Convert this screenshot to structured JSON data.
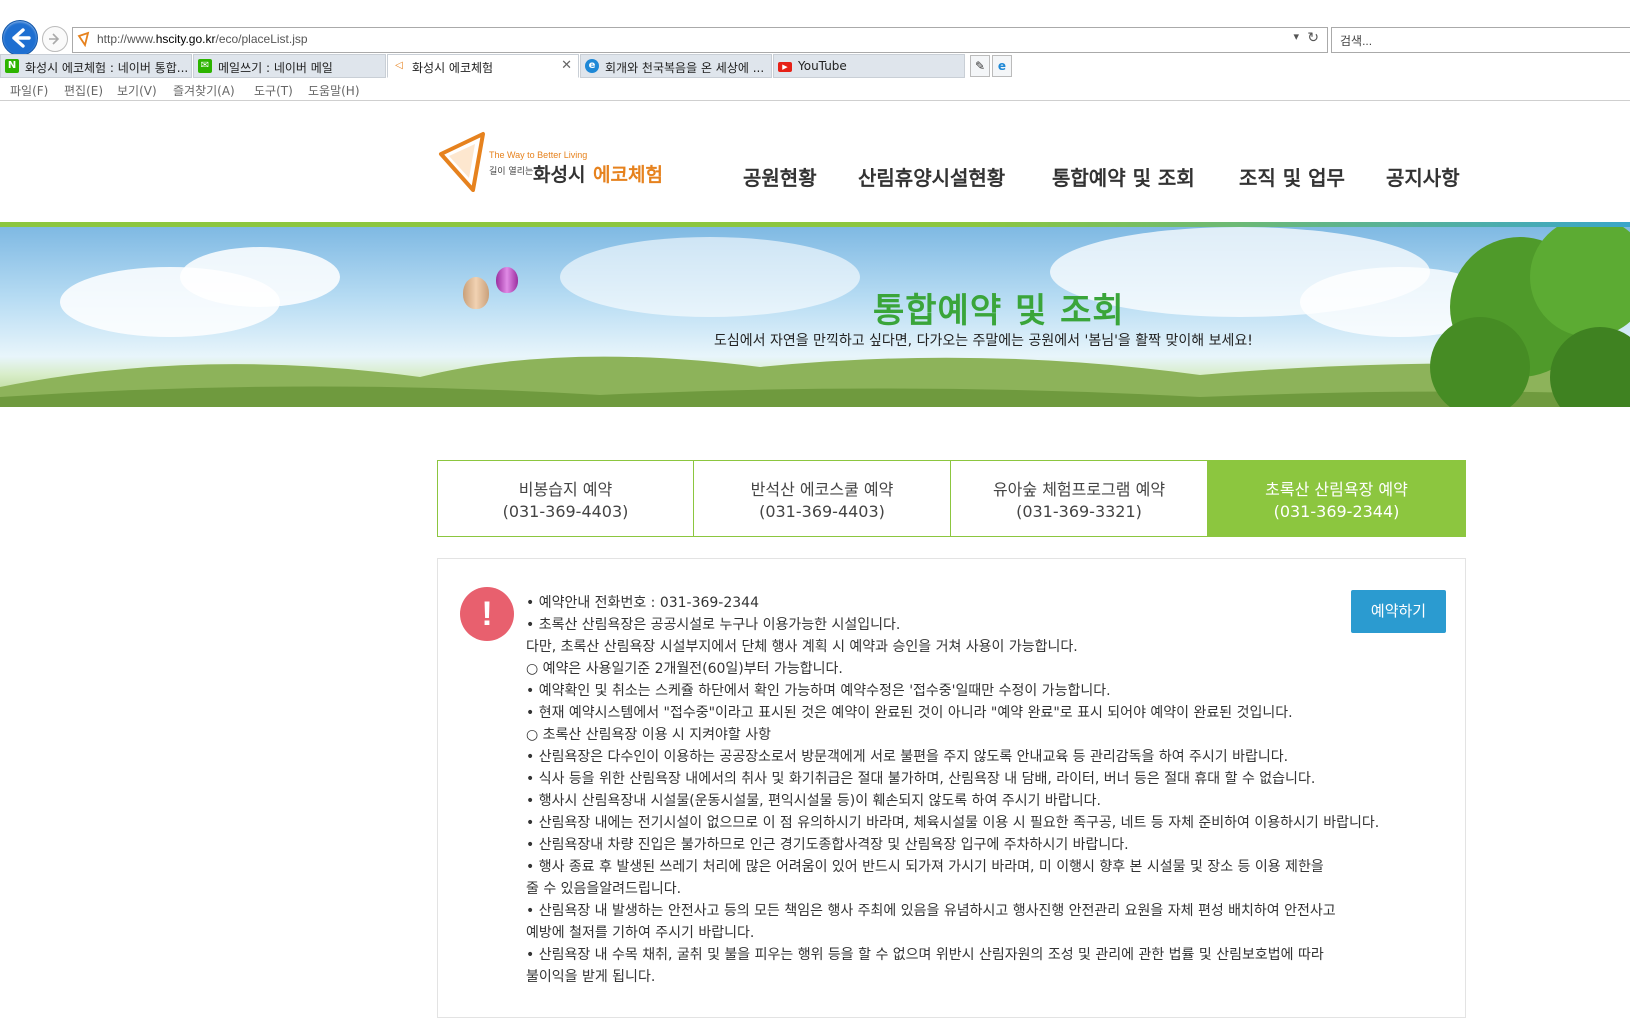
{
  "browser": {
    "url_prefix": "http://www.",
    "url_domain": "hscity.go.kr",
    "url_path": "/eco/placeList.jsp",
    "search_placeholder": "검색...",
    "tabs": [
      {
        "label": "화성시 에코체험 : 네이버 통합...",
        "icon": "naver-icon"
      },
      {
        "label": "메일쓰기 : 네이버 메일",
        "icon": "naver-mail-icon"
      },
      {
        "label": "화성시 에코체험",
        "icon": "hscity-site-icon"
      },
      {
        "label": "회개와 천국복음을 온 세상에 ...",
        "icon": "ie-page-icon"
      },
      {
        "label": "YouTube",
        "icon": "youtube-icon"
      }
    ],
    "menu": [
      "파일(F)",
      "편집(E)",
      "보기(V)",
      "즐겨찾기(A)",
      "도구(T)",
      "도움말(H)"
    ]
  },
  "site": {
    "logo_tagline": "The Way to Better Living",
    "logo_small": "길이 열리는",
    "logo_name_a": "화성시",
    "logo_name_b": "에코체험",
    "nav": [
      "공원현황",
      "산림휴양시설현황",
      "통합예약 및 조회",
      "조직 및 업무",
      "공지사항"
    ]
  },
  "banner": {
    "title": "통합예약 및 조회",
    "subtitle": "도심에서 자연을 만끽하고 싶다면, 다가오는 주말에는 공원에서 '봄님'을 활짝 맞이해 보세요!"
  },
  "reservation_tabs": [
    {
      "name": "비봉습지 예약",
      "phone": "(031-369-4403)",
      "active": false
    },
    {
      "name": "반석산 에코스쿨 예약",
      "phone": "(031-369-4403)",
      "active": false
    },
    {
      "name": "유아숲 체험프로그램 예약",
      "phone": "(031-369-3321)",
      "active": false
    },
    {
      "name": "초록산 산림욕장 예약",
      "phone": "(031-369-2344)",
      "active": true
    }
  ],
  "notice": {
    "reserve_button": "예약하기",
    "lines": [
      "• 예약안내 전화번호 : 031-369-2344",
      "•  초록산 산림욕장은 공공시설로 누구나 이용가능한 시설입니다.",
      "다만, 초록산 산림욕장 시설부지에서 단체 행사 계획 시 예약과 승인을 거쳐 사용이 가능합니다.",
      "○ 예약은 사용일기준 2개월전(60일)부터 가능합니다.",
      "• 예약확인 및 취소는 스케쥴 하단에서 확인 가능하며 예약수정은 '접수중'일때만 수정이 가능합니다.",
      "• 현재 예약시스템에서 \"접수중\"이라고 표시된 것은 예약이 완료된 것이 아니라 \"예약 완료\"로 표시 되어야 예약이 완료된 것입니다.",
      "○ 초록산 산림욕장 이용 시 지켜야할 사항",
      "• 산림욕장은 다수인이 이용하는 공공장소로서 방문객에게 서로 불편을 주지 않도록 안내교육 등 관리감독을 하여 주시기 바랍니다.",
      "• 식사 등을 위한 산림욕장 내에서의 취사 및 화기취급은 절대 불가하며, 산림욕장 내 담배, 라이터, 버너 등은 절대 휴대 할 수 없습니다.",
      "• 행사시 산림욕장내 시설물(운동시설물, 편익시설물 등)이 훼손되지 않도록 하여 주시기 바랍니다.",
      "• 산림욕장 내에는 전기시설이 없으므로 이 점 유의하시기 바라며, 체육시설물 이용 시 필요한 족구공, 네트 등 자체 준비하여 이용하시기 바랍니다.",
      "• 산림욕장내 차량 진입은 불가하므로 인근 경기도종합사격장 및 산림욕장 입구에 주차하시기 바랍니다.",
      "• 행사 종료 후 발생된 쓰레기 처리에 많은 어려움이 있어 반드시 되가져 가시기 바라며, 미 이행시 향후 본 시설물 및 장소 등 이용 제한을",
      "   줄 수 있음을알려드립니다.",
      "• 산림욕장 내 발생하는 안전사고 등의 모든 책임은 행사 주최에 있음을 유념하시고 행사진행 안전관리 요원을 자체 편성 배치하여 안전사고",
      "  예방에 철저를 기하여 주시기 바랍니다.",
      "• 산림욕장 내 수목 채취, 굴취 및 불을 피우는 행위 등을 할 수 없으며 위반시 산림자원의 조성 및 관리에 관한 법률 및 산림보호법에 따라",
      "  불이익을 받게 됩니다."
    ]
  },
  "colors": {
    "accent_green": "#8cc63f",
    "title_green": "#3aa53a",
    "button_blue": "#2b9bd0",
    "alert_red": "#e8606e",
    "brand_orange": "#e6821e"
  }
}
